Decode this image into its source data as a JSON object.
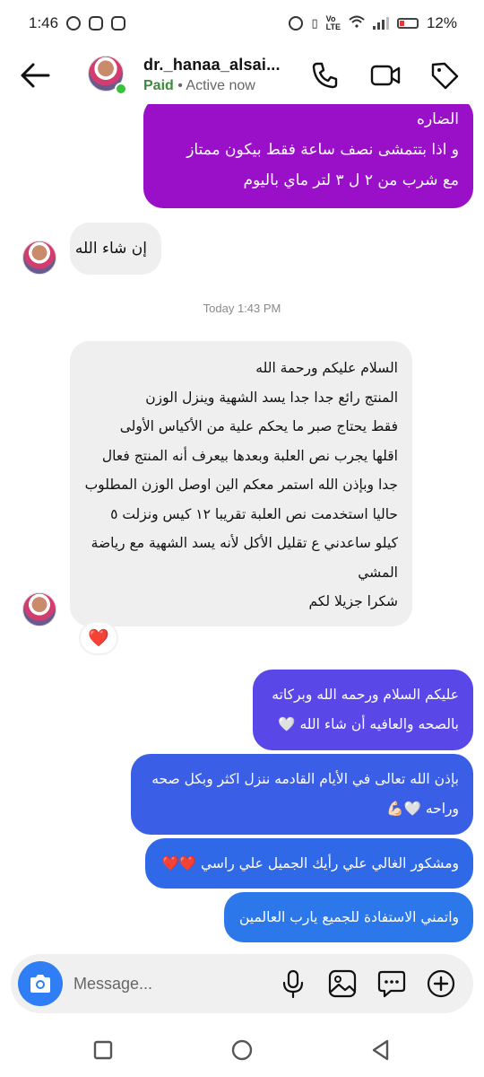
{
  "status_bar": {
    "time": "1:46",
    "battery": "12%"
  },
  "header": {
    "name": "dr._hanaa_alsai...",
    "paid": "Paid",
    "separator": "•",
    "status": "Active now"
  },
  "messages": [
    {
      "direction": "out",
      "color": "#9a10c8",
      "lines": [
        "الضاره",
        "و اذا بتتمشى نصف ساعة فقط بيكون ممتاز",
        "مع شرب من ٢ ل ٣ لتر ماي باليوم"
      ]
    },
    {
      "direction": "in",
      "lines": [
        "إن شاء الله"
      ]
    },
    {
      "direction": "in",
      "lines": [
        "السلام عليكم ورحمة الله",
        "المنتج رائع جدا جدا يسد الشهية وينزل الوزن",
        "فقط يحتاج صبر ما يحكم علية من الأكياس الأولى",
        "اقلها يجرب نص العلبة وبعدها بيعرف أنه المنتج فعال",
        "جدا وبإذن الله استمر معكم الين اوصل الوزن المطلوب",
        "حاليا استخدمت نص العلبة تقريبا ١٢ كيس ونزلت ٥",
        "كيلو ساعدني ع تقليل الأكل لأنه يسد الشهية مع رياضة",
        "المشي",
        "شكرا جزيلا لكم"
      ],
      "reaction": "❤️"
    },
    {
      "direction": "out",
      "color": "#5a47e8",
      "lines": [
        "عليكم السلام ورحمه الله وبركاته",
        "بالصحه والعافيه أن شاء الله 🤍"
      ]
    },
    {
      "direction": "out",
      "color": "#3a5fe6",
      "lines": [
        "بإذن الله تعالى في الأيام القادمه ننزل اكثر وبكل صحه",
        "وراحه 🤍💪🏻"
      ]
    },
    {
      "direction": "out",
      "color": "#3069e8",
      "lines": [
        "ومشكور الغالي علي رأيك الجميل علي راسي ❤️❤️"
      ]
    },
    {
      "direction": "out",
      "color": "#2c78ea",
      "lines": [
        "واتمني الاستفادة للجميع يارب العالمين"
      ]
    }
  ],
  "timestamp": "Today 1:43 PM",
  "composer": {
    "placeholder": "Message..."
  },
  "icons": {
    "back": "back-arrow-icon",
    "call": "phone-icon",
    "video": "video-camera-icon",
    "tag": "tag-icon",
    "camera": "camera-icon",
    "mic": "microphone-icon",
    "gallery": "gallery-icon",
    "sticker": "sticker-icon",
    "add": "add-icon"
  },
  "colors": {
    "online": "#38c33a",
    "camera_button": "#2f7ef5",
    "incoming_bubble": "#efefef"
  }
}
